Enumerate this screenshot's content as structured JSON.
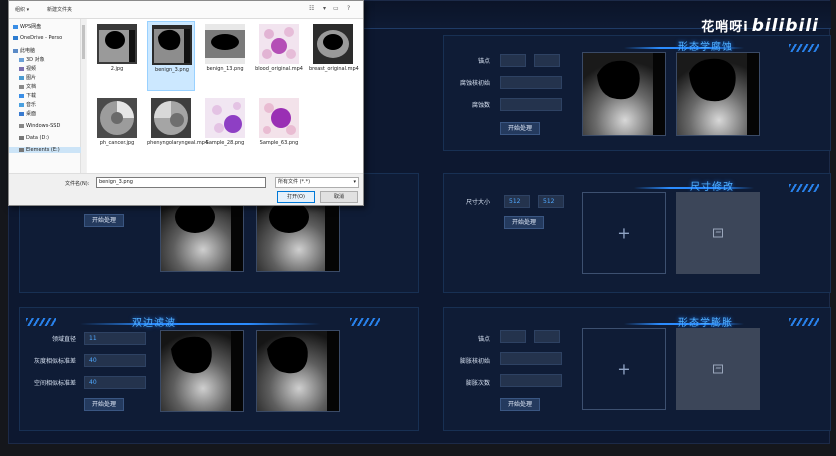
{
  "watermark": {
    "text": "花哨呀i",
    "brand": "bilibili"
  },
  "colors": {
    "accent": "#2b8cff",
    "panel_bg": "#0f1c36",
    "field_bg": "#24334d",
    "button_bg": "#243a5e"
  },
  "panels": {
    "morph_open": {
      "title": "形态学腐蚀",
      "fields": [
        {
          "label": "锚点",
          "value": "",
          "value2": ""
        },
        {
          "label": "腐蚀核初始",
          "value": ""
        },
        {
          "label": "腐蚀数",
          "value": ""
        }
      ],
      "button": "开始处理"
    },
    "resize": {
      "title": "尺寸修改",
      "size_label": "尺寸大小",
      "width_value": "512",
      "height_value": "512",
      "button": "开始处理"
    },
    "left_mid": {
      "button": "开始处理"
    },
    "bilateral": {
      "title": "双边滤波",
      "fields": [
        {
          "label": "领域直径",
          "value": "11"
        },
        {
          "label": "灰度相似标准差",
          "value": "40"
        },
        {
          "label": "空间相似标准差",
          "value": "40"
        }
      ],
      "button": "开始处理"
    },
    "dilate": {
      "title": "形态学膨胀",
      "fields": [
        {
          "label": "锚点",
          "value": "",
          "value2": ""
        },
        {
          "label": "膨胀核初始",
          "value": ""
        },
        {
          "label": "膨胀次数",
          "value": ""
        }
      ],
      "button": "开始处理"
    }
  },
  "dialog": {
    "toolbar": {
      "organize": "组织 ▾",
      "new_folder": "新建文件夹"
    },
    "sidebar": [
      {
        "label": "WPS网盘",
        "color": "#3a8ee6"
      },
      {
        "label": "OneDrive - Perso",
        "color": "#2d7cd1"
      },
      {
        "label": "此电脑",
        "color": "#5a8ac6"
      },
      {
        "label": "3D 对象",
        "color": "#6aa0d8"
      },
      {
        "label": "视频",
        "color": "#7a6fb0"
      },
      {
        "label": "图片",
        "color": "#4a9ad0"
      },
      {
        "label": "文档",
        "color": "#8a8a8a"
      },
      {
        "label": "下载",
        "color": "#3a8ee6"
      },
      {
        "label": "音乐",
        "color": "#4aa0e0"
      },
      {
        "label": "桌面",
        "color": "#3a7bd0"
      },
      {
        "label": "Windows-SSD",
        "color": "#888888"
      },
      {
        "label": "Data (D:)",
        "color": "#777777"
      },
      {
        "label": "Elements (E:)",
        "color": "#777777"
      }
    ],
    "files": [
      {
        "name": "2.jpg",
        "kind": "us-dark"
      },
      {
        "name": "benign_3.png",
        "kind": "us-dark",
        "selected": true
      },
      {
        "name": "benign_13.png",
        "kind": "us-wide"
      },
      {
        "name": "blood_original.mp4",
        "kind": "blood"
      },
      {
        "name": "breast_original.mp4",
        "kind": "us-ring"
      },
      {
        "name": "ph_cancer.jpg",
        "kind": "gray-disc"
      },
      {
        "name": "phenyngolaryngeal.mp4",
        "kind": "gray-disc2"
      },
      {
        "name": "Sample_28.png",
        "kind": "purple"
      },
      {
        "name": "Sample_63.png",
        "kind": "purple2"
      }
    ],
    "filename_label": "文件名(N):",
    "filename_value": "benign_3.png",
    "filetype": "所有文件 (*.*)",
    "open_button": "打开(O)",
    "cancel_button": "取消"
  }
}
